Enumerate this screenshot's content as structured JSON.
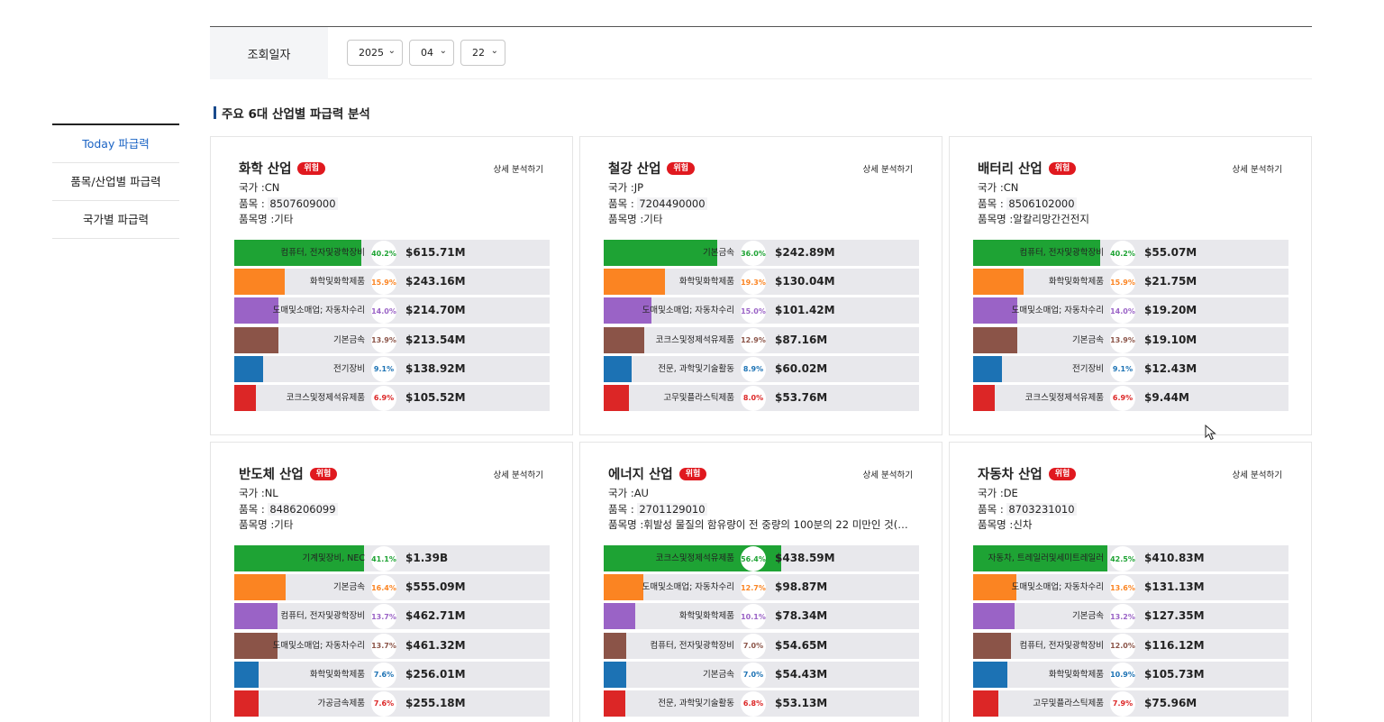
{
  "sidebar": {
    "items": [
      {
        "label": "Today 파급력",
        "active": true
      },
      {
        "label": "품목/산업별 파급력",
        "active": false
      },
      {
        "label": "국가별 파급력",
        "active": false
      }
    ]
  },
  "date_filter": {
    "label": "조회일자",
    "year": "2025",
    "month": "04",
    "day": "22"
  },
  "section_title": "주요 6대 산업별 파급력 분석",
  "colors": {
    "green": "#1ea334",
    "orange": "#fb8422",
    "purple": "#9a63c6",
    "brown": "#8b5448",
    "blue": "#1c72b4",
    "red": "#dc2626",
    "accent": "#1a63c4",
    "badge": "#e0191f"
  },
  "cards": [
    {
      "title": "화학 산업",
      "badge": "위험",
      "detail": "상세 분석하기",
      "country": "국가 :CN",
      "item_label": "품목 :",
      "item_code": "8507609000",
      "item_name": "품목명 :기타",
      "rows": [
        {
          "label": "컴퓨터, 전자및광학장비",
          "pct": "40.2%",
          "value": "$615.71M",
          "share": 0.402,
          "color": "green"
        },
        {
          "label": "화학및화학제품",
          "pct": "15.9%",
          "value": "$243.16M",
          "share": 0.159,
          "color": "orange"
        },
        {
          "label": "도매및소매업; 자동차수리",
          "pct": "14.0%",
          "value": "$214.70M",
          "share": 0.14,
          "color": "purple"
        },
        {
          "label": "기본금속",
          "pct": "13.9%",
          "value": "$213.54M",
          "share": 0.139,
          "color": "brown"
        },
        {
          "label": "전기장비",
          "pct": "9.1%",
          "value": "$138.92M",
          "share": 0.091,
          "color": "blue"
        },
        {
          "label": "코크스및정제석유제품",
          "pct": "6.9%",
          "value": "$105.52M",
          "share": 0.069,
          "color": "red"
        }
      ]
    },
    {
      "title": "철강 산업",
      "badge": "위험",
      "detail": "상세 분석하기",
      "country": "국가 :JP",
      "item_label": "품목 :",
      "item_code": "7204490000",
      "item_name": "품목명 :기타",
      "rows": [
        {
          "label": "기본금속",
          "pct": "36.0%",
          "value": "$242.89M",
          "share": 0.36,
          "color": "green"
        },
        {
          "label": "화학및화학제품",
          "pct": "19.3%",
          "value": "$130.04M",
          "share": 0.193,
          "color": "orange"
        },
        {
          "label": "도매및소매업; 자동차수리",
          "pct": "15.0%",
          "value": "$101.42M",
          "share": 0.15,
          "color": "purple"
        },
        {
          "label": "코크스및정제석유제품",
          "pct": "12.9%",
          "value": "$87.16M",
          "share": 0.129,
          "color": "brown"
        },
        {
          "label": "전문, 과학및기술활동",
          "pct": "8.9%",
          "value": "$60.02M",
          "share": 0.089,
          "color": "blue"
        },
        {
          "label": "고무및플라스틱제품",
          "pct": "8.0%",
          "value": "$53.76M",
          "share": 0.08,
          "color": "red"
        }
      ]
    },
    {
      "title": "배터리 산업",
      "badge": "위험",
      "detail": "상세 분석하기",
      "country": "국가 :CN",
      "item_label": "품목 :",
      "item_code": "8506102000",
      "item_name": "품목명 :알칼리망간건전지",
      "rows": [
        {
          "label": "컴퓨터, 전자및광학장비",
          "pct": "40.2%",
          "value": "$55.07M",
          "share": 0.402,
          "color": "green"
        },
        {
          "label": "화학및화학제품",
          "pct": "15.9%",
          "value": "$21.75M",
          "share": 0.159,
          "color": "orange"
        },
        {
          "label": "도매및소매업; 자동차수리",
          "pct": "14.0%",
          "value": "$19.20M",
          "share": 0.14,
          "color": "purple"
        },
        {
          "label": "기본금속",
          "pct": "13.9%",
          "value": "$19.10M",
          "share": 0.139,
          "color": "brown"
        },
        {
          "label": "전기장비",
          "pct": "9.1%",
          "value": "$12.43M",
          "share": 0.091,
          "color": "blue"
        },
        {
          "label": "코크스및정제석유제품",
          "pct": "6.9%",
          "value": "$9.44M",
          "share": 0.069,
          "color": "red"
        }
      ]
    },
    {
      "title": "반도체 산업",
      "badge": "위험",
      "detail": "상세 분석하기",
      "country": "국가 :NL",
      "item_label": "품목 :",
      "item_code": "8486206099",
      "item_name": "품목명 :기타",
      "rows": [
        {
          "label": "기계및장비, NEC",
          "pct": "41.1%",
          "value": "$1.39B",
          "share": 0.411,
          "color": "green"
        },
        {
          "label": "기본금속",
          "pct": "16.4%",
          "value": "$555.09M",
          "share": 0.164,
          "color": "orange"
        },
        {
          "label": "컴퓨터, 전자및광학장비",
          "pct": "13.7%",
          "value": "$462.71M",
          "share": 0.137,
          "color": "purple"
        },
        {
          "label": "도매및소매업; 자동차수리",
          "pct": "13.7%",
          "value": "$461.32M",
          "share": 0.137,
          "color": "brown"
        },
        {
          "label": "화학및화학제품",
          "pct": "7.6%",
          "value": "$256.01M",
          "share": 0.076,
          "color": "blue"
        },
        {
          "label": "가공금속제품",
          "pct": "7.6%",
          "value": "$255.18M",
          "share": 0.076,
          "color": "red"
        }
      ]
    },
    {
      "title": "에너지 산업",
      "badge": "위험",
      "detail": "상세 분석하기",
      "country": "국가 :AU",
      "item_label": "품목 :",
      "item_code": "2701129010",
      "item_name": "품목명 :휘발성 물질의 함유량이 전 중량의 100분의 22 미만인 것(건...",
      "rows": [
        {
          "label": "코크스및정제석유제품",
          "pct": "56.4%",
          "value": "$438.59M",
          "share": 0.564,
          "color": "green"
        },
        {
          "label": "도매및소매업; 자동차수리",
          "pct": "12.7%",
          "value": "$98.87M",
          "share": 0.127,
          "color": "orange"
        },
        {
          "label": "화학및화학제품",
          "pct": "10.1%",
          "value": "$78.34M",
          "share": 0.101,
          "color": "purple"
        },
        {
          "label": "컴퓨터, 전자및광학장비",
          "pct": "7.0%",
          "value": "$54.65M",
          "share": 0.07,
          "color": "brown"
        },
        {
          "label": "기본금속",
          "pct": "7.0%",
          "value": "$54.43M",
          "share": 0.07,
          "color": "blue"
        },
        {
          "label": "전문, 과학및기술활동",
          "pct": "6.8%",
          "value": "$53.13M",
          "share": 0.068,
          "color": "red"
        }
      ]
    },
    {
      "title": "자동차 산업",
      "badge": "위험",
      "detail": "상세 분석하기",
      "country": "국가 :DE",
      "item_label": "품목 :",
      "item_code": "8703231010",
      "item_name": "품목명 :신차",
      "rows": [
        {
          "label": "자동차, 트레일러및세미트레일러",
          "pct": "42.5%",
          "value": "$410.83M",
          "share": 0.425,
          "color": "green"
        },
        {
          "label": "도매및소매업; 자동차수리",
          "pct": "13.6%",
          "value": "$131.13M",
          "share": 0.136,
          "color": "orange"
        },
        {
          "label": "기본금속",
          "pct": "13.2%",
          "value": "$127.35M",
          "share": 0.132,
          "color": "purple"
        },
        {
          "label": "컴퓨터, 전자및광학장비",
          "pct": "12.0%",
          "value": "$116.12M",
          "share": 0.12,
          "color": "brown"
        },
        {
          "label": "화학및화학제품",
          "pct": "10.9%",
          "value": "$105.73M",
          "share": 0.109,
          "color": "blue"
        },
        {
          "label": "고무및플라스틱제품",
          "pct": "7.9%",
          "value": "$75.96M",
          "share": 0.079,
          "color": "red"
        }
      ]
    }
  ]
}
